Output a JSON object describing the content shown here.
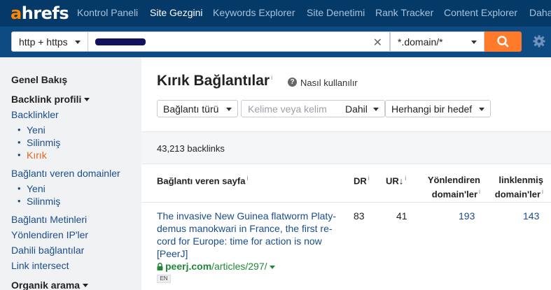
{
  "logo": {
    "accent": "a",
    "rest": "hrefs"
  },
  "nav": [
    "Kontrol Paneli",
    "Site Gezgini",
    "Keywords Explorer",
    "Site Denetimi",
    "Rank Tracker",
    "Content Explorer",
    "Daha"
  ],
  "nav_active": "Site Gezgini",
  "search": {
    "protocol": "http + https",
    "url_value": "",
    "clear_icon": "close-icon",
    "mode": "*.domain/*",
    "search_icon": "search-icon",
    "settings_icon": "gear-icon"
  },
  "sidebar": {
    "overview": "Genel Bakış",
    "backlink_profile": "Backlink profili",
    "backlinks": "Backlinkler",
    "backlinks_sub": [
      "Yeni",
      "Silinmiş",
      "Kırık"
    ],
    "ref_domains": "Bağlantı veren domainler",
    "ref_domains_sub": [
      "Yeni",
      "Silinmiş"
    ],
    "anchors": "Bağlantı Metinleri",
    "ips": "Yönlendiren IP'ler",
    "internal": "Dahili bağlantılar",
    "intersect": "Link intersect",
    "organic": "Organik arama"
  },
  "page": {
    "title": "Kırık Bağlantılar",
    "title_info": "i",
    "help_label": "Nasıl kullanılır",
    "help_icon_glyph": "?"
  },
  "filters": {
    "link_type": "Bağlantı türü",
    "keyword_placeholder": "Kelime veya kelim",
    "include": "Dahil",
    "target": "Herhangi bir hedef"
  },
  "count": "43,213 backlinks",
  "table": {
    "headers": {
      "ref_page": "Bağlantı veren sayfa",
      "dr": "DR",
      "ur": "UR",
      "ur_sort": "↓",
      "ref_domains_l1": "Yönlendiren",
      "ref_domains_l2": "domain'ler",
      "linked_l1": "linklenmiş",
      "linked_l2": "domain'ler",
      "info": "i"
    },
    "rows": [
      {
        "title_lines": [
          "The invasive New Guinea flatworm Platy-",
          "demus manokwari in France, the first re-",
          "cord for Europe: time for action is now",
          "[PeerJ]"
        ],
        "domain": "peerj.com",
        "path": "/articles/297/",
        "lang": "EN",
        "dr": "83",
        "ur": "41",
        "ref_domains": "193",
        "linked_domains": "143"
      }
    ]
  },
  "colors": {
    "nav_bg": "#053a68",
    "search_bg": "#0e4b83",
    "accent_orange": "#ff7a2b",
    "link_blue": "#1a4d8c",
    "active_orange": "#e8651a",
    "domain_green": "#1e8a35"
  }
}
